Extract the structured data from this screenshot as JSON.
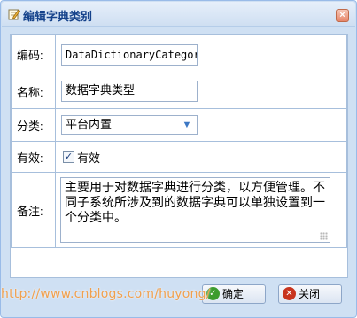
{
  "dialog": {
    "title": "编辑字典类别",
    "icon": "edit-icon",
    "close_icon": "close-icon"
  },
  "form": {
    "code_label": "编码:",
    "code_value": "DataDictionaryCategor:",
    "name_label": "名称:",
    "name_value": "数据字典类型",
    "category_label": "分类:",
    "category_value": "平台内置",
    "valid_label": "有效:",
    "valid_checked": true,
    "valid_checkbox_label": "有效",
    "remark_label": "备注:",
    "remark_value": "主要用于对数据字典进行分类，以方便管理。不同子系统所涉及到的数据字典可以单独设置到一个分类中。"
  },
  "buttons": {
    "ok_label": "确定",
    "close_label": "关闭"
  },
  "watermark": "http://www.cnblogs.com/huyong/",
  "colors": {
    "title_text": "#15428b",
    "panel_border": "#a7bfdc",
    "ok_icon": "#3c9c2e",
    "close_icon": "#c8341e",
    "watermark": "#f0a04e"
  }
}
